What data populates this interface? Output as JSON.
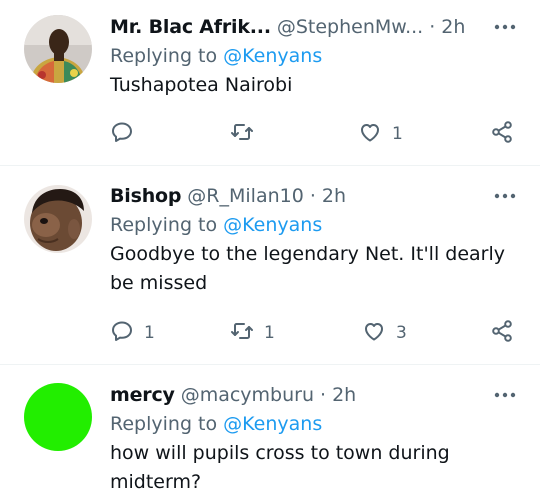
{
  "tweets": [
    {
      "name": "Mr. Blac Afrik...",
      "handle": "@StephenMw...",
      "dot": "·",
      "time": "2h",
      "replying_prefix": "Replying to",
      "replying_to": "@Kenyans",
      "text": "Tushapotea Nairobi",
      "reply_count": "",
      "retweet_count": "",
      "like_count": "1",
      "avatar": "photo-man-in-colorful-shirt"
    },
    {
      "name": "Bishop",
      "handle": "@R_Milan10",
      "dot": "·",
      "time": "2h",
      "replying_prefix": "Replying to",
      "replying_to": "@Kenyans",
      "text": "Goodbye to the legendary Net. It'll dearly be missed",
      "reply_count": "1",
      "retweet_count": "1",
      "like_count": "3",
      "avatar": "photo-child-face"
    },
    {
      "name": "mercy",
      "handle": "@macymburu",
      "dot": "·",
      "time": "2h",
      "replying_prefix": "Replying to",
      "replying_to": "@Kenyans",
      "text": "how will pupils cross to town during midterm?",
      "avatar": "green-circle"
    }
  ],
  "colors": {
    "link": "#1d9bf0",
    "secondary": "#536471",
    "primary": "#0f1419",
    "avatar_green": "#22ee00"
  },
  "icons": [
    "more-icon",
    "reply-icon",
    "retweet-icon",
    "like-icon",
    "share-icon"
  ]
}
